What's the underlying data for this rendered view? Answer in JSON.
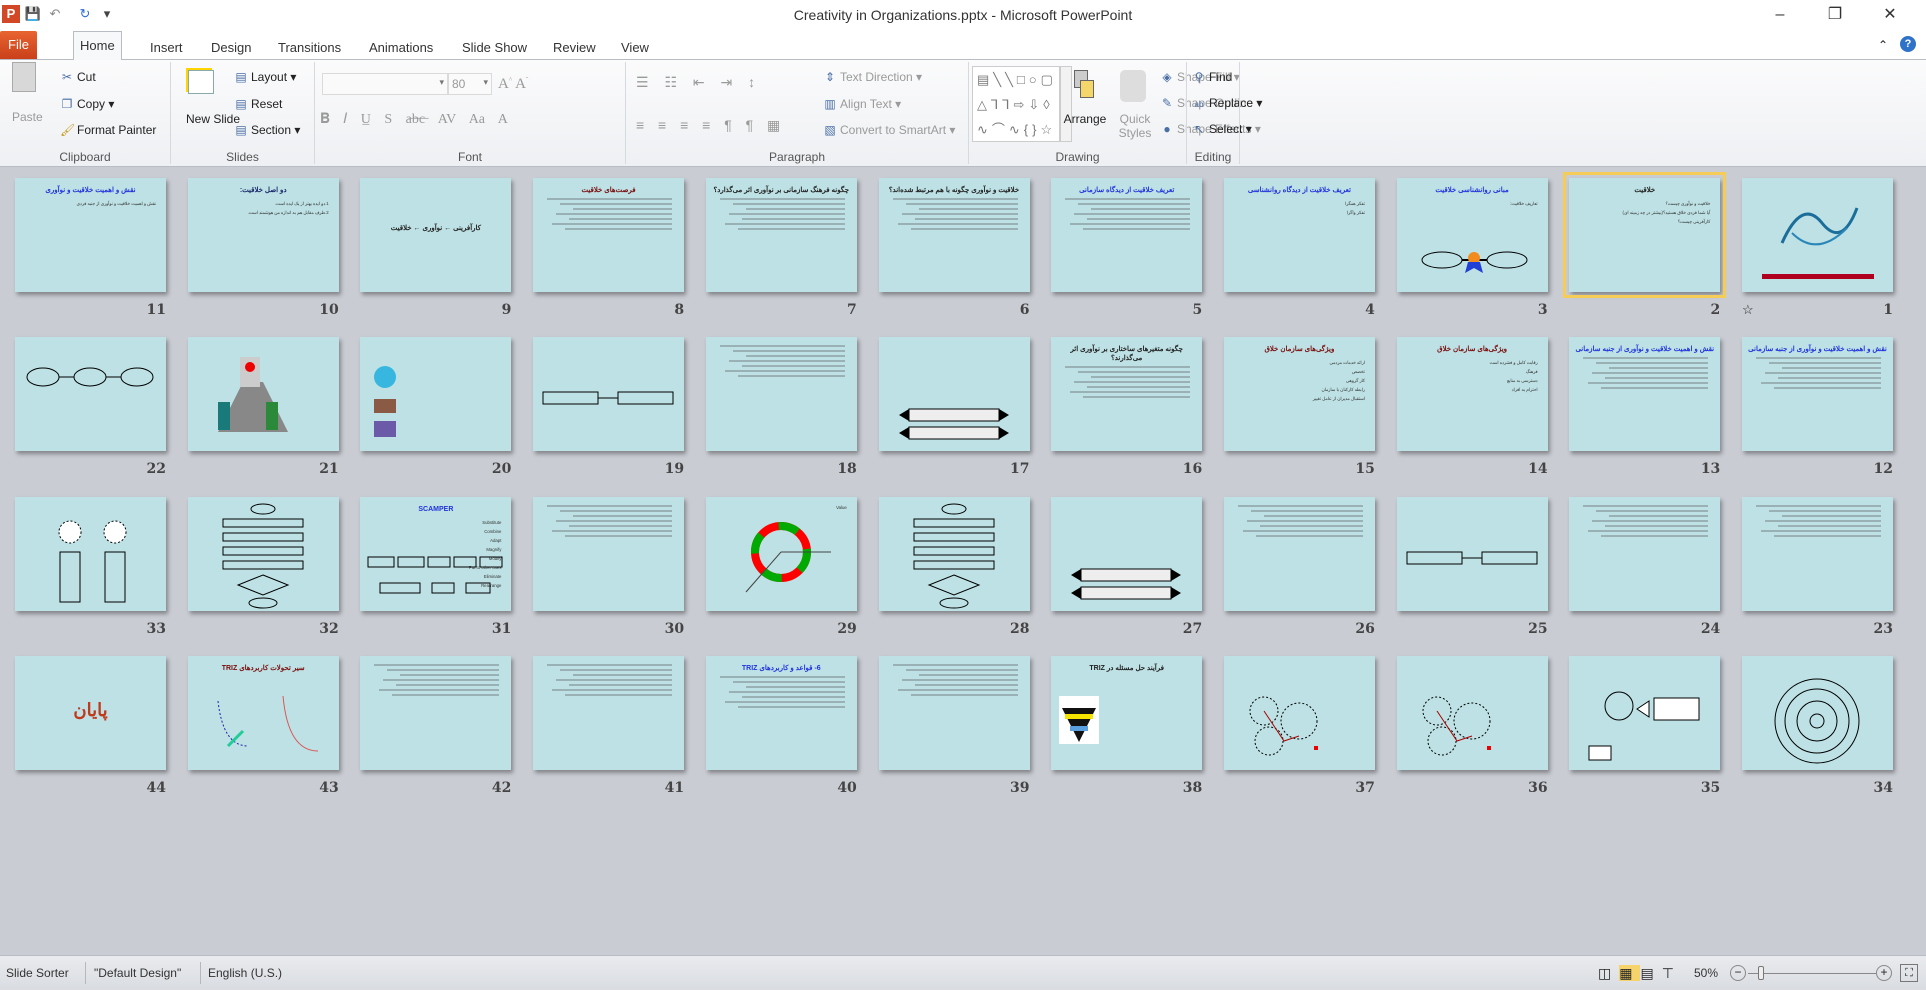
{
  "window": {
    "title": "Creativity in Organizations.pptx - Microsoft PowerPoint",
    "minimize": "–",
    "restore": "❐",
    "close": "✕"
  },
  "quick_access": [
    "powerpoint-logo",
    "save-icon",
    "undo-icon",
    "redo-icon",
    "customize-icon"
  ],
  "tabs": {
    "file": "File",
    "items": [
      "Home",
      "Insert",
      "Design",
      "Transitions",
      "Animations",
      "Slide Show",
      "Review",
      "View"
    ],
    "active": "Home"
  },
  "ribbon": {
    "clipboard": {
      "label": "Clipboard",
      "paste": "Paste",
      "cut": "Cut",
      "copy": "Copy",
      "format_painter": "Format Painter"
    },
    "slides": {
      "label": "Slides",
      "new_slide": "New Slide",
      "layout": "Layout",
      "reset": "Reset",
      "section": "Section"
    },
    "font": {
      "label": "Font",
      "font_name": "",
      "font_size": "80"
    },
    "paragraph": {
      "label": "Paragraph",
      "text_direction": "Text Direction",
      "align_text": "Align Text",
      "convert_smartart": "Convert to SmartArt"
    },
    "drawing": {
      "label": "Drawing",
      "arrange": "Arrange",
      "quick_styles": "Quick Styles",
      "shape_fill": "Shape Fill",
      "shape_outline": "Shape Outline",
      "shape_effects": "Shape Effects"
    },
    "editing": {
      "label": "Editing",
      "find": "Find",
      "replace": "Replace",
      "select": "Select"
    }
  },
  "slides": [
    {
      "num": "1",
      "title": "",
      "color": "#1b6e9a",
      "lines": [],
      "deco": "calligraphy"
    },
    {
      "num": "2",
      "title": "خلاقیت",
      "color": "#222",
      "lines": [
        "خلاقیت و نوآوری چیست؟",
        "آیا شما فردی خلاق هستید؟(بیشتر در چه زمینه ای)",
        "کارآفرینی چیست؟"
      ],
      "selected": true
    },
    {
      "num": "3",
      "title": "مبانی روانشناسی خلاقیت",
      "color": "#2233dd",
      "lines": [
        "تعاریف خلاقیت:"
      ],
      "deco": "ribbon"
    },
    {
      "num": "4",
      "title": "تعریف خلاقیت از دیدگاه روانشناسی",
      "color": "#2233dd",
      "lines": [
        "تفکر همگرا",
        "تفکر واگرا"
      ]
    },
    {
      "num": "5",
      "title": "تعریف خلاقیت از دیدگاه سازمانی",
      "color": "#2233dd",
      "lines": []
    },
    {
      "num": "6",
      "title": "خلاقیت و نوآوری چگونه با هم مرتبط شده‌اند؟",
      "color": "#222",
      "lines": []
    },
    {
      "num": "7",
      "title": "چگونه فرهنگ سازمانی بر نوآوری اثر می‌گذارد؟",
      "color": "#222",
      "lines": []
    },
    {
      "num": "8",
      "title": "فرصت‌های خلاقیت",
      "color": "#7a0c0c",
      "lines": []
    },
    {
      "num": "9",
      "title": "کارآفرینی ← نوآوری ← خلاقیت",
      "color": "#222",
      "lines": [],
      "mid": true
    },
    {
      "num": "10",
      "title": "دو اصل خلاقیت:",
      "color": "#1a2a6a",
      "lines": [
        "1.دو ایده بهتر از یک ایده است.",
        "2.طرف مقابل هم به اندازه من هوشمند است."
      ]
    },
    {
      "num": "11",
      "title": "نقش و اهمیت خلاقیت و نوآوری",
      "color": "#2233dd",
      "lines": [
        "نقش و اهمیت خلاقیت و نوآوری از جنبه فردی"
      ]
    },
    {
      "num": "12",
      "title": "نقش و اهمیت خلاقیت و نوآوری از جنبه سازمانی",
      "color": "#2233dd",
      "lines": []
    },
    {
      "num": "13",
      "title": "نقش و اهمیت خلاقیت و نوآوری از جنبه سازمانی",
      "color": "#2233dd",
      "lines": []
    },
    {
      "num": "14",
      "title": "ویژگی‌های سازمان خلاق",
      "color": "#7a0c0c",
      "lines": [
        "رقابت کامل و فشرده است",
        "فرهنگ",
        "دسترسی به منابع",
        "احترام به افراد"
      ]
    },
    {
      "num": "15",
      "title": "ویژگی‌های سازمان خلاق",
      "color": "#7a0c0c",
      "lines": [
        "ارائه خدمات مردمی",
        "تخصص",
        "کار گروهی",
        "رابطه کارکنان با سازمان",
        "استقبال مدیران از عامل تغییر"
      ]
    },
    {
      "num": "16",
      "title": "چگونه متغیرهای ساختاری بر نوآوری اثر می‌گذارند؟",
      "color": "#222",
      "lines": []
    },
    {
      "num": "17",
      "title": "",
      "color": "#222",
      "lines": [],
      "deco": "banners"
    },
    {
      "num": "18",
      "title": "",
      "color": "#2233dd",
      "lines": []
    },
    {
      "num": "19",
      "title": "",
      "color": "#2233dd",
      "lines": [],
      "deco": "boxes"
    },
    {
      "num": "20",
      "title": "",
      "color": "#2233dd",
      "lines": [],
      "deco": "pictures"
    },
    {
      "num": "21",
      "title": "",
      "color": "#2233dd",
      "lines": [],
      "deco": "teacher"
    },
    {
      "num": "22",
      "title": "",
      "color": "#2233dd",
      "lines": [],
      "deco": "chain"
    },
    {
      "num": "23",
      "title": "",
      "color": "#2233dd",
      "lines": []
    },
    {
      "num": "24",
      "title": "",
      "color": "#2233dd",
      "lines": []
    },
    {
      "num": "25",
      "title": "",
      "color": "#2233dd",
      "lines": [],
      "deco": "boxes"
    },
    {
      "num": "26",
      "title": "",
      "color": "#2233dd",
      "lines": []
    },
    {
      "num": "27",
      "title": "",
      "color": "#222",
      "lines": [],
      "deco": "banners"
    },
    {
      "num": "28",
      "title": "",
      "color": "#2233dd",
      "lines": [],
      "deco": "flowchart"
    },
    {
      "num": "29",
      "title": "",
      "color": "#222",
      "lines": [
        "Value"
      ],
      "deco": "wheel"
    },
    {
      "num": "30",
      "title": "",
      "color": "#2233dd",
      "lines": []
    },
    {
      "num": "31",
      "title": "SCAMPER",
      "color": "#2233dd",
      "lines": [
        "Substitute",
        "Combine",
        "Adapt",
        "Magnify",
        "Modify",
        "Put to other uses",
        "Eliminate",
        "Rearrange"
      ],
      "deco": "scamper"
    },
    {
      "num": "32",
      "title": "",
      "color": "#2233dd",
      "lines": [],
      "deco": "flowchart"
    },
    {
      "num": "33",
      "title": "",
      "color": "#2233dd",
      "lines": [],
      "deco": "stars"
    },
    {
      "num": "34",
      "title": "",
      "color": "#2233dd",
      "lines": [],
      "deco": "circles"
    },
    {
      "num": "35",
      "title": "",
      "color": "#2233dd",
      "lines": [],
      "deco": "face"
    },
    {
      "num": "36",
      "title": "",
      "color": "#2233dd",
      "lines": [],
      "deco": "vectors"
    },
    {
      "num": "37",
      "title": "",
      "color": "#7a0c0c",
      "lines": [],
      "deco": "vectors"
    },
    {
      "num": "38",
      "title": "فرآیند حل مسئله در TRIZ",
      "color": "#222",
      "lines": [],
      "deco": "triangle"
    },
    {
      "num": "39",
      "title": "",
      "color": "#222",
      "lines": []
    },
    {
      "num": "40",
      "title": "6- قواعد و کاربردهای TRIZ",
      "color": "#2233dd",
      "lines": []
    },
    {
      "num": "41",
      "title": "",
      "color": "#222",
      "lines": []
    },
    {
      "num": "42",
      "title": "",
      "color": "#222",
      "lines": []
    },
    {
      "num": "43",
      "title": "سیر تحولات کاربردهای TRIZ",
      "color": "#7a0c0c",
      "lines": [],
      "deco": "curves"
    },
    {
      "num": "44",
      "title": "پایان",
      "color": "#c0391b",
      "lines": [],
      "big": true
    }
  ],
  "status": {
    "view": "Slide Sorter",
    "theme": "\"Default Design\"",
    "language": "English (U.S.)",
    "zoom": "50%",
    "zoom_percent": 50
  }
}
